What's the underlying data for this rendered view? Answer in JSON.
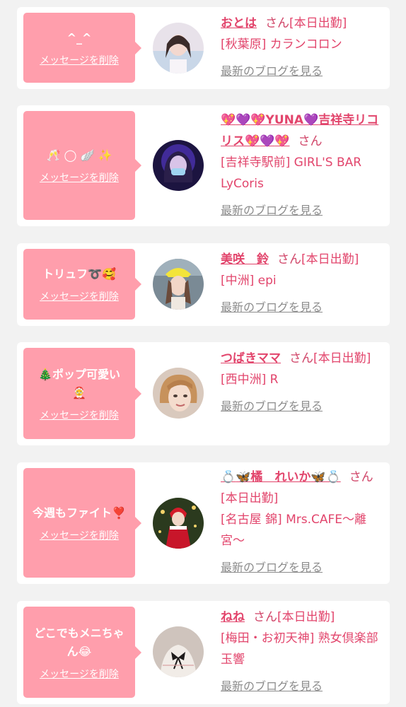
{
  "colors": {
    "page_bg": "#f2f2f2",
    "card_bg": "#ffffff",
    "bubble_bg": "#ff9eac",
    "accent_pink": "#e2456c",
    "link_gray": "#8c8c8c"
  },
  "delete_label": "メッセージを削除",
  "honorific": "さん",
  "blog_label": "最新のブログを見る",
  "cards": [
    {
      "message": "^_^",
      "name": "おとは",
      "status": "[本日出勤]",
      "shop": "[秋葉原] カランコロン"
    },
    {
      "message": "🥂 ◯ 🪽 ✨",
      "name_parts": [
        "💖",
        "💜",
        "💖",
        "YUNA",
        "💜",
        "吉祥寺リコリス",
        "💖",
        "💜",
        "💖"
      ],
      "status": "",
      "shop": "[吉祥寺駅前] GIRL'S BAR LyCoris"
    },
    {
      "message": "トリュフ",
      "message_emoji": "➰🥰",
      "name": "美咲　鈴",
      "status": "[本日出勤]",
      "shop": "[中洲] epi"
    },
    {
      "message_emoji_lead": "🎄",
      "message": "ポップ可愛い",
      "message_emoji": "🤶",
      "name": "つばきママ",
      "status": "[本日出勤]",
      "shop": "[西中洲] R"
    },
    {
      "message": "今週もファイト",
      "message_emoji": "❣️",
      "name_parts": [
        "💍",
        "🦋",
        "橘　れいか",
        "🦋",
        "💍"
      ],
      "status": "[本日出勤]",
      "shop": "[名古屋 錦] Mrs.CAFE〜離宮〜"
    },
    {
      "message": "どこでもメニちゃん",
      "message_emoji": "😂",
      "name": "ねね",
      "status": "[本日出勤]",
      "shop": "[梅田・お初天神] 熟女倶楽部 玉響"
    }
  ]
}
